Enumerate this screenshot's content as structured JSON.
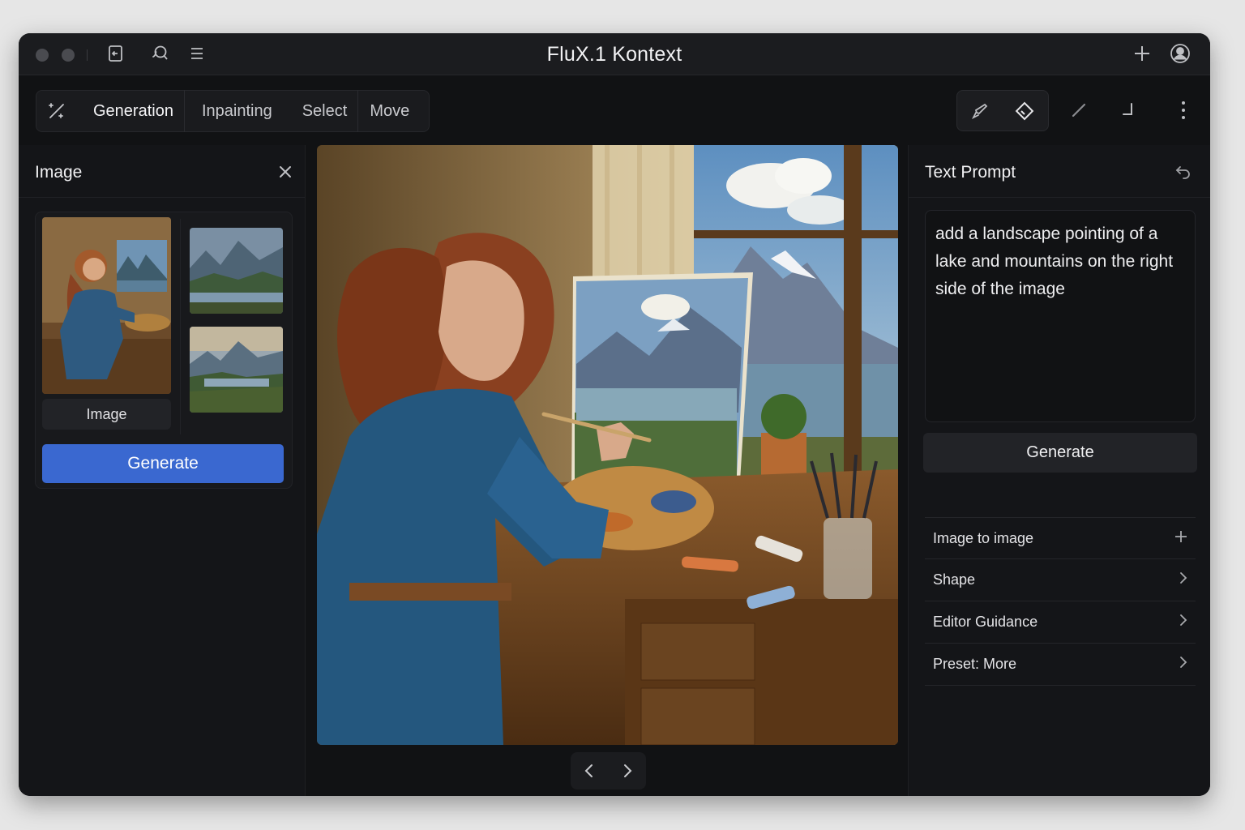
{
  "window": {
    "title": "FluX.1 Kontext",
    "controls": [
      "close-dot",
      "minimize-dot"
    ],
    "left_icons": [
      "import-icon",
      "search-icon",
      "menu-icon"
    ],
    "right_icons": [
      "plus-icon",
      "account-icon"
    ]
  },
  "toolbar": {
    "magic_icon": "magic-wand-icon",
    "tabs": [
      {
        "label": "Generation",
        "active": true
      },
      {
        "label": "Inpainting",
        "active": false
      },
      {
        "label": "Select",
        "active": false
      },
      {
        "label": "Move",
        "active": false
      }
    ],
    "tools": [
      "brush-icon",
      "eraser-icon",
      "pen-icon",
      "corner-icon",
      "more-vertical-icon"
    ]
  },
  "left_panel": {
    "title": "Image",
    "thumb_label": "Image",
    "generate_label": "Generate"
  },
  "canvas": {
    "nav": [
      "chevron-left-icon",
      "chevron-right-icon"
    ]
  },
  "right_panel": {
    "title": "Text Prompt",
    "prompt_text": "add a landscape pointing of a lake and mountains on the right side of the image",
    "generate_label": "Generate",
    "options": [
      {
        "label": "Image to image",
        "icon": "plus-icon"
      },
      {
        "label": "Shape",
        "icon": "chevron-right-icon"
      },
      {
        "label": "Editor Guidance",
        "icon": "chevron-right-icon"
      },
      {
        "label": "Preset: More",
        "icon": "chevron-right-icon"
      }
    ]
  },
  "colors": {
    "background": "#111214",
    "panel": "#141518",
    "accent_blue": "#3a68d0"
  }
}
